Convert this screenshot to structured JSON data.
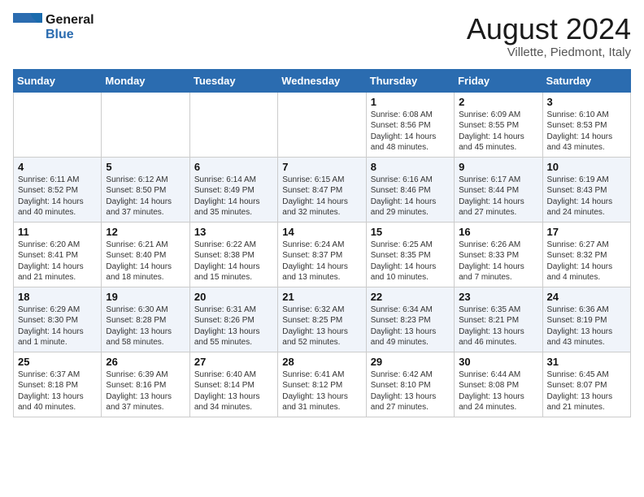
{
  "header": {
    "logo_line1": "General",
    "logo_line2": "Blue",
    "month_title": "August 2024",
    "location": "Villette, Piedmont, Italy"
  },
  "weekdays": [
    "Sunday",
    "Monday",
    "Tuesday",
    "Wednesday",
    "Thursday",
    "Friday",
    "Saturday"
  ],
  "weeks": [
    [
      {
        "day": "",
        "info": ""
      },
      {
        "day": "",
        "info": ""
      },
      {
        "day": "",
        "info": ""
      },
      {
        "day": "",
        "info": ""
      },
      {
        "day": "1",
        "info": "Sunrise: 6:08 AM\nSunset: 8:56 PM\nDaylight: 14 hours\nand 48 minutes."
      },
      {
        "day": "2",
        "info": "Sunrise: 6:09 AM\nSunset: 8:55 PM\nDaylight: 14 hours\nand 45 minutes."
      },
      {
        "day": "3",
        "info": "Sunrise: 6:10 AM\nSunset: 8:53 PM\nDaylight: 14 hours\nand 43 minutes."
      }
    ],
    [
      {
        "day": "4",
        "info": "Sunrise: 6:11 AM\nSunset: 8:52 PM\nDaylight: 14 hours\nand 40 minutes."
      },
      {
        "day": "5",
        "info": "Sunrise: 6:12 AM\nSunset: 8:50 PM\nDaylight: 14 hours\nand 37 minutes."
      },
      {
        "day": "6",
        "info": "Sunrise: 6:14 AM\nSunset: 8:49 PM\nDaylight: 14 hours\nand 35 minutes."
      },
      {
        "day": "7",
        "info": "Sunrise: 6:15 AM\nSunset: 8:47 PM\nDaylight: 14 hours\nand 32 minutes."
      },
      {
        "day": "8",
        "info": "Sunrise: 6:16 AM\nSunset: 8:46 PM\nDaylight: 14 hours\nand 29 minutes."
      },
      {
        "day": "9",
        "info": "Sunrise: 6:17 AM\nSunset: 8:44 PM\nDaylight: 14 hours\nand 27 minutes."
      },
      {
        "day": "10",
        "info": "Sunrise: 6:19 AM\nSunset: 8:43 PM\nDaylight: 14 hours\nand 24 minutes."
      }
    ],
    [
      {
        "day": "11",
        "info": "Sunrise: 6:20 AM\nSunset: 8:41 PM\nDaylight: 14 hours\nand 21 minutes."
      },
      {
        "day": "12",
        "info": "Sunrise: 6:21 AM\nSunset: 8:40 PM\nDaylight: 14 hours\nand 18 minutes."
      },
      {
        "day": "13",
        "info": "Sunrise: 6:22 AM\nSunset: 8:38 PM\nDaylight: 14 hours\nand 15 minutes."
      },
      {
        "day": "14",
        "info": "Sunrise: 6:24 AM\nSunset: 8:37 PM\nDaylight: 14 hours\nand 13 minutes."
      },
      {
        "day": "15",
        "info": "Sunrise: 6:25 AM\nSunset: 8:35 PM\nDaylight: 14 hours\nand 10 minutes."
      },
      {
        "day": "16",
        "info": "Sunrise: 6:26 AM\nSunset: 8:33 PM\nDaylight: 14 hours\nand 7 minutes."
      },
      {
        "day": "17",
        "info": "Sunrise: 6:27 AM\nSunset: 8:32 PM\nDaylight: 14 hours\nand 4 minutes."
      }
    ],
    [
      {
        "day": "18",
        "info": "Sunrise: 6:29 AM\nSunset: 8:30 PM\nDaylight: 14 hours\nand 1 minute."
      },
      {
        "day": "19",
        "info": "Sunrise: 6:30 AM\nSunset: 8:28 PM\nDaylight: 13 hours\nand 58 minutes."
      },
      {
        "day": "20",
        "info": "Sunrise: 6:31 AM\nSunset: 8:26 PM\nDaylight: 13 hours\nand 55 minutes."
      },
      {
        "day": "21",
        "info": "Sunrise: 6:32 AM\nSunset: 8:25 PM\nDaylight: 13 hours\nand 52 minutes."
      },
      {
        "day": "22",
        "info": "Sunrise: 6:34 AM\nSunset: 8:23 PM\nDaylight: 13 hours\nand 49 minutes."
      },
      {
        "day": "23",
        "info": "Sunrise: 6:35 AM\nSunset: 8:21 PM\nDaylight: 13 hours\nand 46 minutes."
      },
      {
        "day": "24",
        "info": "Sunrise: 6:36 AM\nSunset: 8:19 PM\nDaylight: 13 hours\nand 43 minutes."
      }
    ],
    [
      {
        "day": "25",
        "info": "Sunrise: 6:37 AM\nSunset: 8:18 PM\nDaylight: 13 hours\nand 40 minutes."
      },
      {
        "day": "26",
        "info": "Sunrise: 6:39 AM\nSunset: 8:16 PM\nDaylight: 13 hours\nand 37 minutes."
      },
      {
        "day": "27",
        "info": "Sunrise: 6:40 AM\nSunset: 8:14 PM\nDaylight: 13 hours\nand 34 minutes."
      },
      {
        "day": "28",
        "info": "Sunrise: 6:41 AM\nSunset: 8:12 PM\nDaylight: 13 hours\nand 31 minutes."
      },
      {
        "day": "29",
        "info": "Sunrise: 6:42 AM\nSunset: 8:10 PM\nDaylight: 13 hours\nand 27 minutes."
      },
      {
        "day": "30",
        "info": "Sunrise: 6:44 AM\nSunset: 8:08 PM\nDaylight: 13 hours\nand 24 minutes."
      },
      {
        "day": "31",
        "info": "Sunrise: 6:45 AM\nSunset: 8:07 PM\nDaylight: 13 hours\nand 21 minutes."
      }
    ]
  ]
}
